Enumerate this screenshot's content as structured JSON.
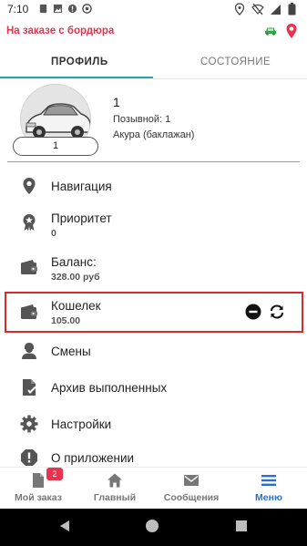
{
  "status_bar": {
    "time": "7:10",
    "icons": [
      "sim-card-icon",
      "image-icon",
      "alert-icon",
      "vpn-icon",
      "location-icon",
      "wifi-off-icon",
      "signal-icon",
      "battery-icon"
    ]
  },
  "header": {
    "title": "На заказе с бордюра",
    "icons": [
      "car-icon",
      "map-pin-icon"
    ],
    "colors": {
      "title": "#e8334f",
      "car": "#3aa84a",
      "pin": "#e8334f"
    }
  },
  "tabs": [
    {
      "label": "ПРОФИЛЬ",
      "active": true
    },
    {
      "label": "СОСТОЯНИЕ",
      "active": false
    }
  ],
  "profile": {
    "name": "1",
    "callsign": "Позывной: 1",
    "car": "Акура (баклажан)",
    "badge": "1"
  },
  "menu": [
    {
      "label": "Навигация",
      "icon": "location-pin-icon"
    },
    {
      "label": "Приоритет",
      "sub": "0",
      "icon": "award-icon"
    },
    {
      "label": "Баланс:",
      "sub": "328.00 руб",
      "icon": "wallet-icon"
    },
    {
      "label": "Кошелек",
      "sub": "105.00",
      "icon": "wallet-icon",
      "highlighted": true
    },
    {
      "label": "Смены",
      "icon": "person-icon"
    },
    {
      "label": "Архив выполненных",
      "icon": "document-check-icon"
    },
    {
      "label": "Настройки",
      "icon": "gear-icon"
    },
    {
      "label": "О приложении",
      "icon": "info-alert-icon"
    }
  ],
  "bottom_nav": [
    {
      "label": "Мой заказ",
      "icon": "document-icon",
      "badge": "2",
      "active": false
    },
    {
      "label": "Главный",
      "icon": "home-icon",
      "active": false
    },
    {
      "label": "Сообщения",
      "icon": "mail-icon",
      "active": false
    },
    {
      "label": "Меню",
      "icon": "hamburger-menu-icon",
      "active": true
    }
  ],
  "colors": {
    "accent": "#2aa3a8",
    "nav_active": "#2a6fc9",
    "highlight_border": "#d62b2b"
  }
}
